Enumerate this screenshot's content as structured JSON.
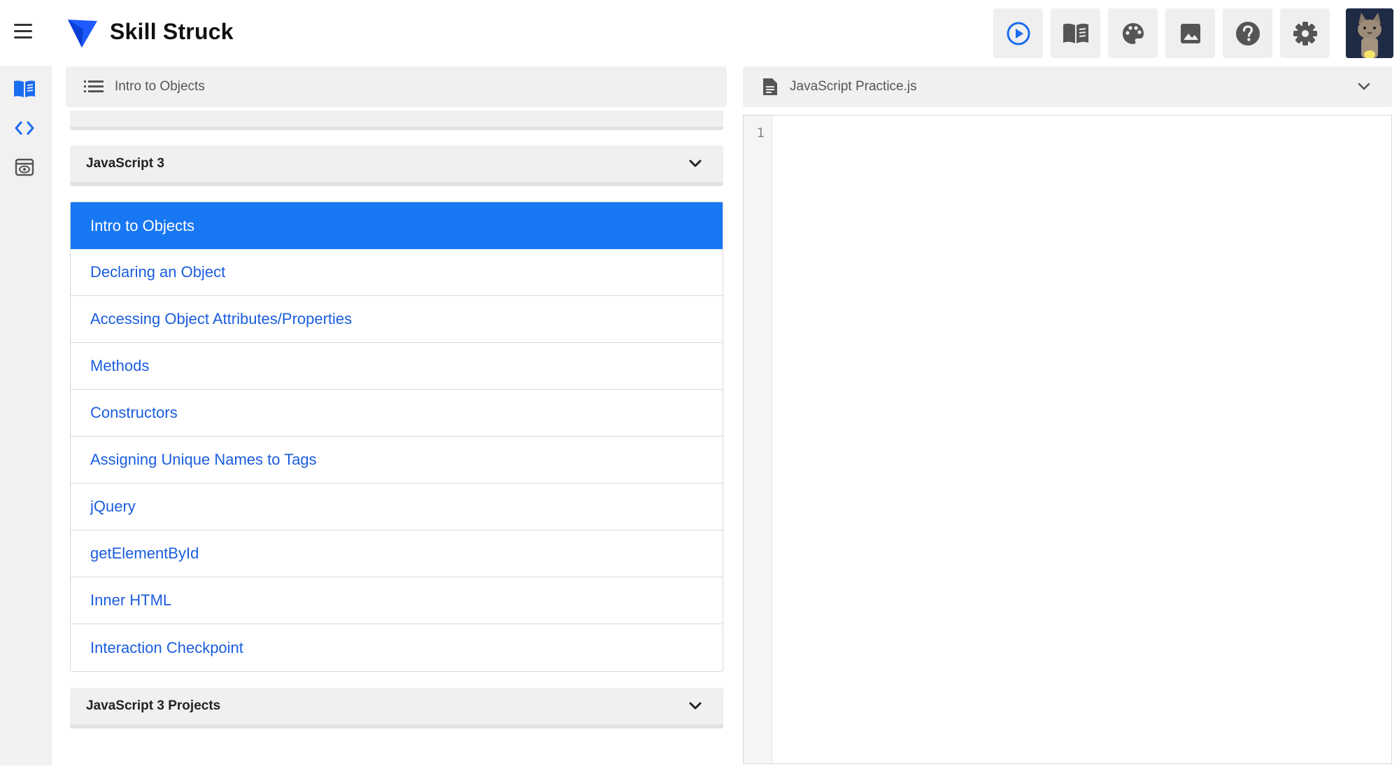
{
  "app": {
    "brand_name": "Skill Struck",
    "accent_color": "#1877f2",
    "logo_color": "#1e5bff"
  },
  "toolbar": {
    "buttons": [
      {
        "name": "run",
        "icon": "play-circle-icon"
      },
      {
        "name": "instructions",
        "icon": "book-icon"
      },
      {
        "name": "theme",
        "icon": "palette-icon"
      },
      {
        "name": "images",
        "icon": "image-icon"
      },
      {
        "name": "help",
        "icon": "help-circle-icon"
      },
      {
        "name": "settings",
        "icon": "gear-icon"
      }
    ],
    "avatar": "cat-avatar"
  },
  "rail": {
    "items": [
      {
        "name": "lessons",
        "icon": "book-open-icon",
        "active": true
      },
      {
        "name": "code",
        "icon": "code-icon",
        "active": false
      },
      {
        "name": "preview",
        "icon": "eye-icon",
        "active": false
      }
    ]
  },
  "lesson_panel": {
    "header_title": "Intro to Objects",
    "sections": [
      {
        "label": "JavaScript 3",
        "expanded": true
      },
      {
        "label": "JavaScript 3 Projects",
        "expanded": false
      }
    ],
    "lessons": [
      {
        "label": "Intro to Objects",
        "active": true
      },
      {
        "label": "Declaring an Object",
        "active": false
      },
      {
        "label": "Accessing Object Attributes/Properties",
        "active": false
      },
      {
        "label": "Methods",
        "active": false
      },
      {
        "label": "Constructors",
        "active": false
      },
      {
        "label": "Assigning Unique Names to Tags",
        "active": false
      },
      {
        "label": "jQuery",
        "active": false
      },
      {
        "label": "getElementById",
        "active": false
      },
      {
        "label": "Inner HTML",
        "active": false
      },
      {
        "label": "Interaction Checkpoint",
        "active": false
      }
    ]
  },
  "editor": {
    "file_name": "JavaScript Practice.js",
    "line_numbers": [
      "1"
    ],
    "content": ""
  }
}
